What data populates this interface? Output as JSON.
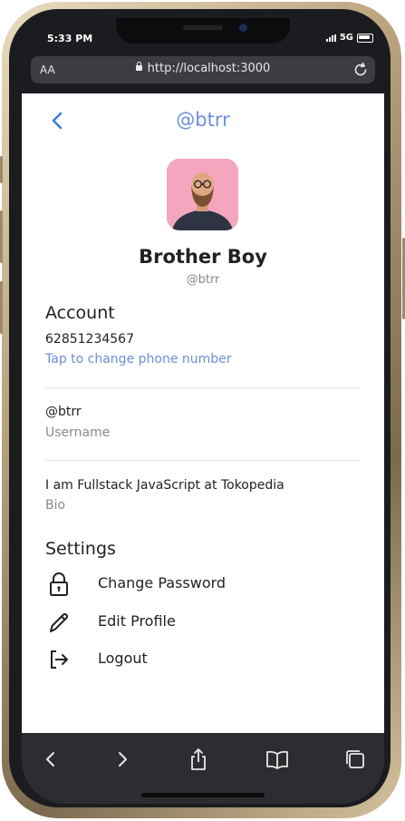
{
  "status": {
    "time": "5:33 PM",
    "network": "5G"
  },
  "browser": {
    "text_size_label": "AA",
    "url": "http://localhost:3000"
  },
  "header": {
    "title": "@btrr"
  },
  "profile": {
    "name": "Brother Boy",
    "handle": "@btrr"
  },
  "account": {
    "title": "Account",
    "phone": "62851234567",
    "phone_hint": "Tap to change phone number",
    "username_value": "@btrr",
    "username_label": "Username",
    "bio_value": "I am Fullstack JavaScript at Tokopedia",
    "bio_label": "Bio"
  },
  "settings": {
    "title": "Settings",
    "items": [
      {
        "label": "Change Password",
        "icon": "lock-icon"
      },
      {
        "label": "Edit Profile",
        "icon": "pencil-icon"
      },
      {
        "label": "Logout",
        "icon": "logout-icon"
      }
    ]
  },
  "colors": {
    "accent": "#6c8fd8",
    "back_arrow": "#3e7be0",
    "browser_chrome": "#2c2d31"
  }
}
